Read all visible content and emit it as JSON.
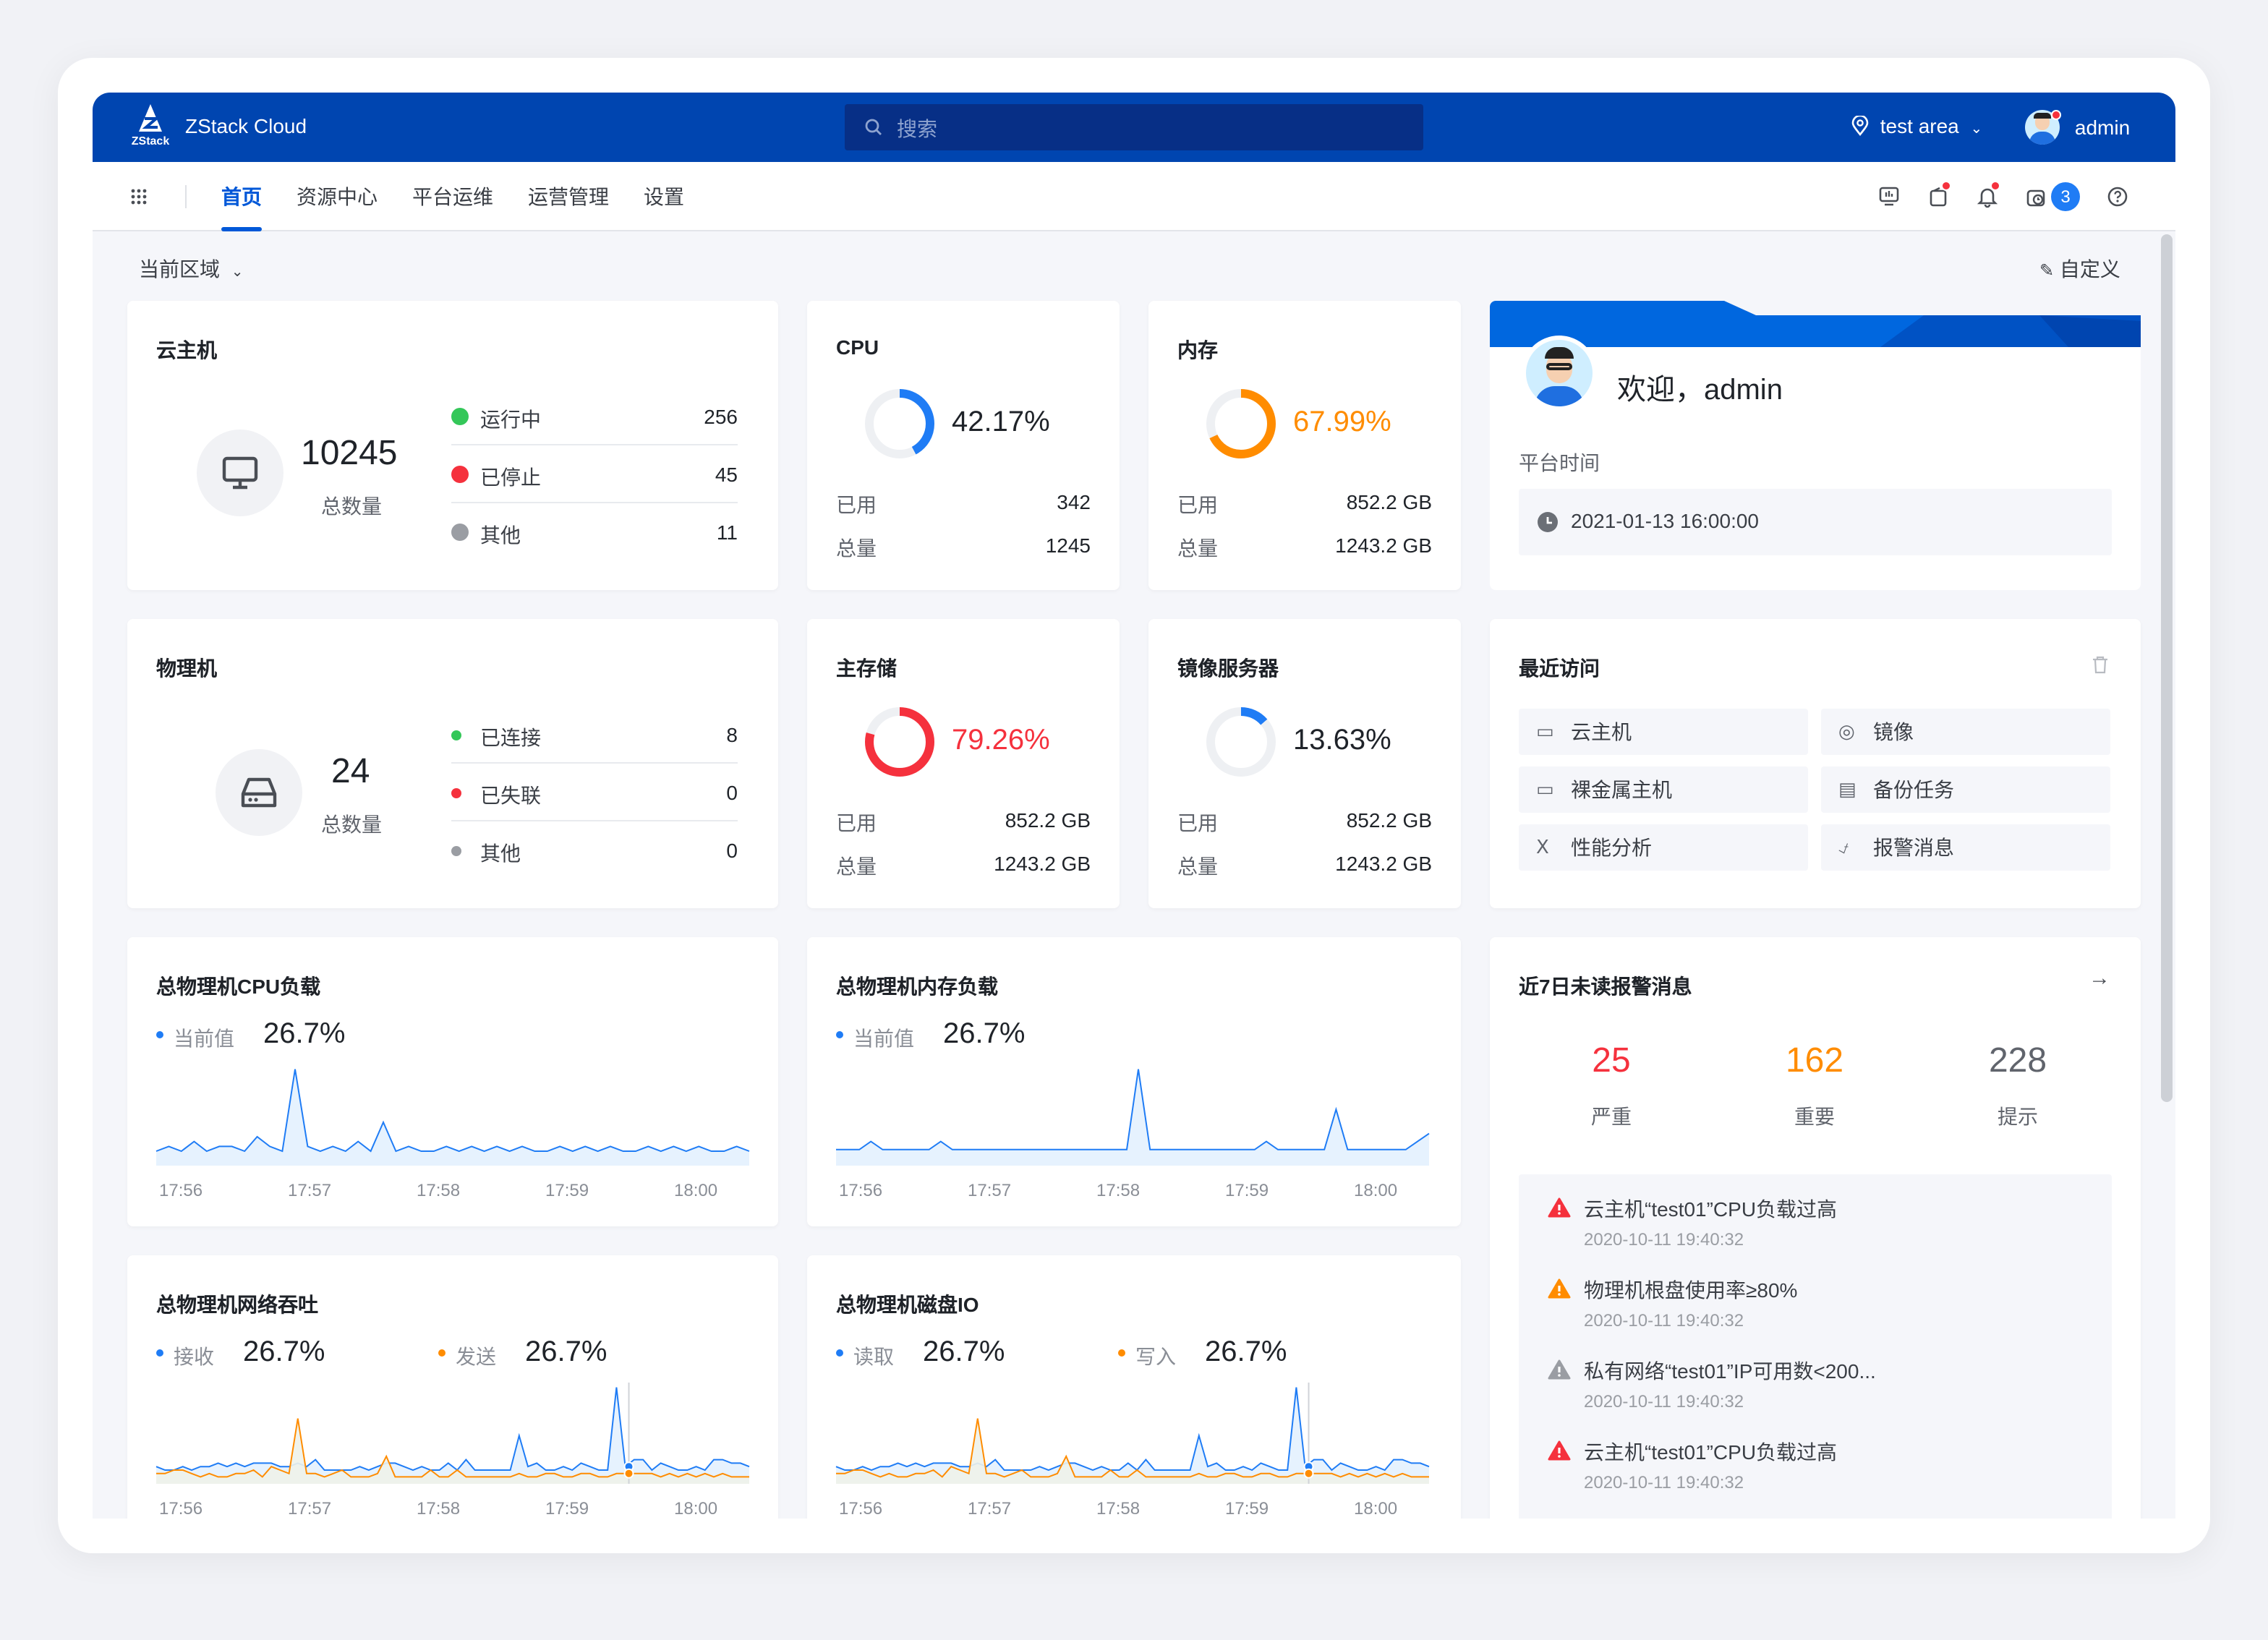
{
  "header": {
    "logo_text": "ZStack",
    "app_title": "ZStack Cloud",
    "search_placeholder": "搜索",
    "area": "test area",
    "user": "admin"
  },
  "nav": {
    "items": [
      "首页",
      "资源中心",
      "平台运维",
      "运营管理",
      "设置"
    ],
    "active": "首页",
    "task_badge": "3"
  },
  "toolbar": {
    "region_label": "当前区域",
    "customize_label": "自定义"
  },
  "vm_card": {
    "title": "云主机",
    "total": "10245",
    "total_label": "总数量",
    "statuses": [
      {
        "label": "运行中",
        "value": "256",
        "color": "#34c759"
      },
      {
        "label": "已停止",
        "value": "45",
        "color": "#f5313d"
      },
      {
        "label": "其他",
        "value": "11",
        "color": "#9a9da3"
      }
    ]
  },
  "cpu_card": {
    "title": "CPU",
    "percent": "42.17%",
    "fraction": 0.4217,
    "color": "#1f7cf5",
    "used_label": "已用",
    "used": "342",
    "total_label": "总量",
    "total": "1245"
  },
  "mem_card": {
    "title": "内存",
    "percent": "67.99%",
    "fraction": 0.6799,
    "color": "#ff8c00",
    "used_label": "已用",
    "used": "852.2 GB",
    "total_label": "总量",
    "total": "1243.2 GB"
  },
  "welcome": {
    "greeting": "欢迎，admin",
    "time_label": "平台时间",
    "time": "2021-01-13 16:00:00"
  },
  "host_card": {
    "title": "物理机",
    "total": "24",
    "total_label": "总数量",
    "statuses": [
      {
        "label": "已连接",
        "value": "8",
        "color": "#34c759"
      },
      {
        "label": "已失联",
        "value": "0",
        "color": "#f5313d"
      },
      {
        "label": "其他",
        "value": "0",
        "color": "#9a9da3"
      }
    ]
  },
  "storage_card": {
    "title": "主存储",
    "percent": "79.26%",
    "fraction": 0.7926,
    "color": "#f5313d",
    "used_label": "已用",
    "used": "852.2 GB",
    "total_label": "总量",
    "total": "1243.2 GB"
  },
  "image_card": {
    "title": "镜像服务器",
    "percent": "13.63%",
    "fraction": 0.1363,
    "color": "#1f7cf5",
    "used_label": "已用",
    "used": "852.2 GB",
    "total_label": "总量",
    "total": "1243.2 GB"
  },
  "recent": {
    "title": "最近访问",
    "items": [
      {
        "label": "云主机",
        "icon": "monitor-icon"
      },
      {
        "label": "镜像",
        "icon": "disc-icon"
      },
      {
        "label": "裸金属主机",
        "icon": "monitor-icon"
      },
      {
        "label": "备份任务",
        "icon": "backup-icon"
      },
      {
        "label": "性能分析",
        "icon": "bar-chart-icon"
      },
      {
        "label": "报警消息",
        "icon": "bell-icon"
      }
    ]
  },
  "alerts": {
    "title": "近7日未读报警消息",
    "counts": [
      {
        "value": "25",
        "label": "严重",
        "color": "#f5313d"
      },
      {
        "value": "162",
        "label": "重要",
        "color": "#ff8c00"
      },
      {
        "value": "228",
        "label": "提示",
        "color": "#60646c"
      }
    ],
    "items": [
      {
        "text": "云主机“test01”CPU负载过高",
        "time": "2020-10-11 19:40:32",
        "color": "#f5313d"
      },
      {
        "text": "物理机根盘使用率≥80%",
        "time": "2020-10-11 19:40:32",
        "color": "#ff8c00"
      },
      {
        "text": "私有网络“test01”IP可用数<200...",
        "time": "2020-10-11 19:40:32",
        "color": "#9a9da3"
      },
      {
        "text": "云主机“test01”CPU负载过高",
        "time": "2020-10-11 19:40:32",
        "color": "#f5313d"
      }
    ]
  },
  "chart_data": [
    {
      "type": "area",
      "title": "总物理机CPU负载",
      "x_ticks": [
        "17:56",
        "17:57",
        "17:58",
        "17:59",
        "18:00"
      ],
      "series": [
        {
          "name": "当前值",
          "current": "26.7%",
          "color": "#1f7cf5",
          "values": [
            3,
            4,
            3,
            5,
            3,
            4,
            4,
            3,
            6,
            4,
            3,
            20,
            4,
            3,
            4,
            3,
            5,
            3,
            9,
            3,
            4,
            3,
            3,
            4,
            3,
            4,
            3,
            4,
            3,
            4,
            3,
            3,
            4,
            3,
            4,
            3,
            4,
            3,
            3,
            4,
            3,
            4,
            3,
            4,
            3,
            3,
            4,
            3
          ]
        }
      ]
    },
    {
      "type": "area",
      "title": "总物理机内存负载",
      "x_ticks": [
        "17:56",
        "17:57",
        "17:58",
        "17:59",
        "18:00"
      ],
      "series": [
        {
          "name": "当前值",
          "current": "26.7%",
          "color": "#1f7cf5",
          "values": [
            2,
            2,
            2,
            3,
            2,
            2,
            2,
            2,
            2,
            3,
            2,
            2,
            2,
            2,
            2,
            2,
            2,
            2,
            2,
            2,
            2,
            2,
            2,
            2,
            2,
            2,
            12,
            2,
            2,
            2,
            2,
            2,
            2,
            2,
            2,
            2,
            2,
            3,
            2,
            2,
            2,
            2,
            2,
            7,
            2,
            2,
            2,
            2,
            2,
            2,
            3,
            4
          ]
        }
      ]
    },
    {
      "type": "area",
      "title": "总物理机网络吞吐",
      "x_ticks": [
        "17:56",
        "17:57",
        "17:58",
        "17:59",
        "18:00"
      ],
      "series": [
        {
          "name": "接收",
          "current": "26.7%",
          "color": "#1f7cf5",
          "values": [
            5,
            4,
            4,
            5,
            4,
            5,
            5,
            6,
            5,
            6,
            5,
            6,
            6,
            6,
            5,
            5,
            6,
            5,
            7,
            4,
            4,
            4,
            4,
            5,
            4,
            5,
            6,
            6,
            5,
            4,
            5,
            4,
            4,
            6,
            4,
            7,
            4,
            4,
            4,
            4,
            4,
            14,
            5,
            6,
            4,
            4,
            5,
            4,
            6,
            5,
            4,
            4,
            28,
            5,
            7,
            7,
            4,
            6,
            5,
            4,
            4,
            5,
            4,
            7,
            7,
            6,
            6,
            5
          ]
        },
        {
          "name": "发送",
          "current": "26.7%",
          "color": "#ff8c00",
          "values": [
            3,
            3,
            4,
            4,
            3,
            2,
            3,
            2,
            2,
            3,
            3,
            4,
            2,
            5,
            4,
            3,
            19,
            3,
            3,
            2,
            3,
            4,
            2,
            2,
            2,
            3,
            8,
            2,
            2,
            2,
            2,
            4,
            2,
            2,
            4,
            2,
            2,
            2,
            2,
            2,
            2,
            3,
            2,
            2,
            3,
            3,
            2,
            2,
            3,
            3,
            2,
            2,
            3,
            3,
            3,
            3,
            3,
            2,
            3,
            2,
            3,
            2,
            3,
            2,
            3,
            2,
            2,
            2
          ]
        }
      ]
    },
    {
      "type": "area",
      "title": "总物理机磁盘IO",
      "x_ticks": [
        "17:56",
        "17:57",
        "17:58",
        "17:59",
        "18:00"
      ],
      "series": [
        {
          "name": "读取",
          "current": "26.7%",
          "color": "#1f7cf5",
          "values": [
            5,
            4,
            4,
            5,
            4,
            5,
            5,
            6,
            5,
            6,
            5,
            6,
            6,
            6,
            5,
            5,
            6,
            5,
            7,
            4,
            4,
            4,
            4,
            5,
            4,
            5,
            6,
            6,
            5,
            4,
            5,
            4,
            4,
            6,
            4,
            7,
            4,
            4,
            4,
            4,
            4,
            14,
            5,
            6,
            4,
            4,
            5,
            4,
            6,
            5,
            4,
            4,
            28,
            5,
            7,
            7,
            4,
            6,
            5,
            4,
            4,
            5,
            4,
            7,
            7,
            6,
            6,
            5
          ]
        },
        {
          "name": "写入",
          "current": "26.7%",
          "color": "#ff8c00",
          "values": [
            3,
            3,
            4,
            4,
            3,
            2,
            3,
            2,
            2,
            3,
            3,
            4,
            2,
            5,
            4,
            3,
            19,
            3,
            3,
            2,
            3,
            4,
            2,
            2,
            2,
            3,
            8,
            2,
            2,
            2,
            2,
            4,
            2,
            2,
            4,
            2,
            2,
            2,
            2,
            2,
            2,
            3,
            2,
            2,
            3,
            3,
            2,
            2,
            3,
            3,
            2,
            2,
            3,
            3,
            3,
            3,
            3,
            2,
            3,
            2,
            3,
            2,
            3,
            2,
            3,
            2,
            2,
            2
          ]
        }
      ]
    }
  ]
}
